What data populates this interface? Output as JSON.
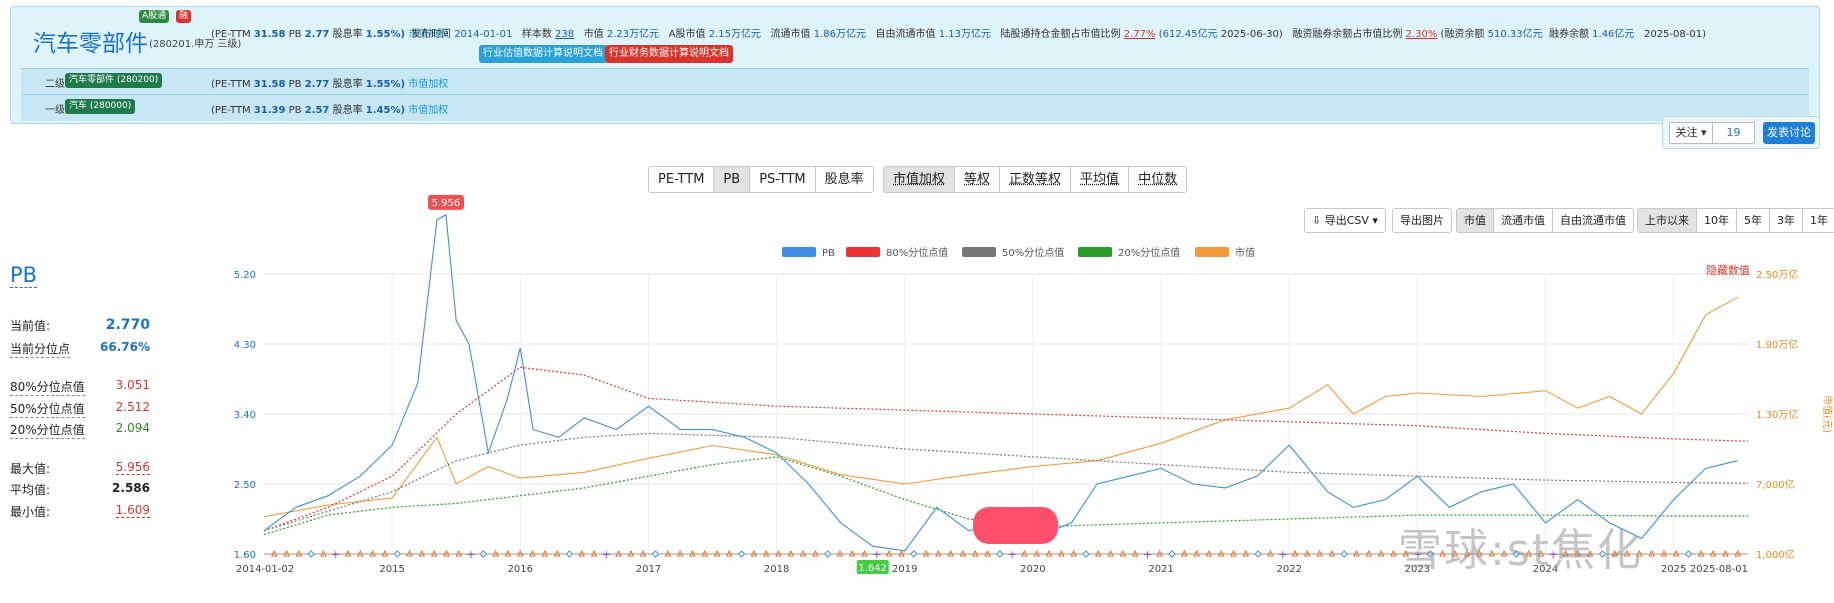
{
  "header": {
    "name": "汽车零部件",
    "code": "(280201.申万 三级)",
    "badges": {
      "ashare": "A股通",
      "margin": "融"
    },
    "valuation": {
      "pe_label": "(PE-TTM",
      "pe": "31.58",
      "pb_label": "PB",
      "pb": "2.77",
      "dy_label": "股息率",
      "dy": "1.55%)",
      "weight": "市值加权"
    },
    "info": {
      "pub_label": "发布时间",
      "pub_value": "2014-01-01",
      "samples_label": "样本数",
      "samples_value": "238",
      "mcap_label": "市值",
      "mcap_value": "2.23万亿元",
      "amcap_label": "A股市值",
      "amcap_value": "2.15万亿元",
      "float_label": "流通市值",
      "float_value": "1.86万亿元",
      "freefloat_label": "自由流通市值",
      "freefloat_value": "1.13万亿元",
      "hk_label": "陆股通持仓金额占市值比例",
      "hk_ratio": "2.77%",
      "hk_amount": "(612.45亿元",
      "hk_date": "2025-06-30)",
      "margin_label": "融资融券余额占市值比例",
      "margin_ratio": "2.30%",
      "margin_fin_label": "(融资余额",
      "margin_fin": "510.33亿元",
      "margin_sec_label": "融券余额",
      "margin_sec": "1.46亿元",
      "margin_date": "2025-08-01)"
    },
    "docs": {
      "val_doc": "行业估值数据计算说明文档",
      "fin_doc": "行业财务数据计算说明文档"
    }
  },
  "level2": {
    "label": "二级:",
    "tag": "汽车零部件 (280200)",
    "pe_label": "(PE-TTM",
    "pe": "31.58",
    "pb_label": "PB",
    "pb": "2.77",
    "dy_label": "股息率",
    "dy": "1.55%)",
    "weight": "市值加权"
  },
  "level1": {
    "label": "一级:",
    "tag": "汽车 (280000)",
    "pe_label": "(PE-TTM",
    "pe": "31.39",
    "pb_label": "PB",
    "pb": "2.57",
    "dy_label": "股息率",
    "dy": "1.45%)",
    "weight": "市值加权"
  },
  "actions": {
    "follow": "关注",
    "count": "19",
    "post": "发表讨论"
  },
  "metric_tabs": [
    "PE-TTM",
    "PB",
    "PS-TTM",
    "股息率"
  ],
  "metric_active": 1,
  "method_tabs": [
    "市值加权",
    "等权",
    "正数等权",
    "平均值",
    "中位数"
  ],
  "method_active": 0,
  "toolbar": {
    "export_csv": "导出CSV",
    "export_img": "导出图片"
  },
  "base_tabs": [
    "市值",
    "流通市值",
    "自由流通市值"
  ],
  "range_tabs": [
    "上市以来",
    "10年",
    "5年",
    "3年",
    "1年"
  ],
  "stats": {
    "title": "PB",
    "current_label": "当前值:",
    "current": "2.770",
    "pct_label": "当前分位点",
    "pct": "66.76%",
    "p80_label": "80%分位点值",
    "p80": "3.051",
    "p50_label": "50%分位点值",
    "p50": "2.512",
    "p20_label": "20%分位点值",
    "p20": "2.094",
    "max_label": "最大值:",
    "max": "5.956",
    "avg_label": "平均值:",
    "avg": "2.586",
    "min_label": "最小值:",
    "min": "1.609"
  },
  "watermark": "雪球:st焦化",
  "colors": {
    "pb": "#3c8ee6",
    "p80": "#ee3333",
    "p50": "#777777",
    "p20": "#2a9a2a",
    "mcap": "#f59a3c"
  },
  "chart_data": {
    "type": "line",
    "legend": [
      "PB",
      "80%分位点值",
      "50%分位点值",
      "20%分位点值",
      "市值"
    ],
    "hide_values": "隐藏数值",
    "x_ticks": [
      "2014-01-02",
      "2015",
      "2016",
      "2017",
      "2018",
      "2019",
      "2020",
      "2021",
      "2022",
      "2023",
      "2024",
      "2025",
      "2025-08-01"
    ],
    "y_left_ticks": [
      "1.60",
      "2.50",
      "3.40",
      "4.30",
      "5.20"
    ],
    "y_left_range": [
      1.6,
      5.2
    ],
    "y_right_ticks": [
      "1,000亿",
      "7,000亿",
      "1.30万亿",
      "1.90万亿",
      "2.50万亿"
    ],
    "y_right_range": [
      1000,
      25000
    ],
    "y_right_label": "市值(元)",
    "max_label": "5.956",
    "min_label": "1.642",
    "series": [
      {
        "name": "PB",
        "x": [
          2014.0,
          2014.25,
          2014.5,
          2014.75,
          2015.0,
          2015.2,
          2015.35,
          2015.42,
          2015.5,
          2015.6,
          2015.75,
          2015.9,
          2016.0,
          2016.1,
          2016.3,
          2016.5,
          2016.75,
          2017.0,
          2017.25,
          2017.5,
          2017.75,
          2018.0,
          2018.25,
          2018.5,
          2018.75,
          2019.0,
          2019.25,
          2019.5,
          2019.75,
          2020.0,
          2020.15,
          2020.3,
          2020.5,
          2020.75,
          2021.0,
          2021.25,
          2021.5,
          2021.75,
          2022.0,
          2022.3,
          2022.5,
          2022.75,
          2023.0,
          2023.25,
          2023.5,
          2023.75,
          2024.0,
          2024.25,
          2024.5,
          2024.75,
          2025.0,
          2025.25,
          2025.5
        ],
        "y": [
          1.9,
          2.2,
          2.35,
          2.6,
          3.0,
          3.8,
          5.9,
          5.96,
          4.6,
          4.3,
          2.9,
          3.6,
          4.25,
          3.2,
          3.1,
          3.35,
          3.2,
          3.5,
          3.2,
          3.2,
          3.1,
          2.9,
          2.5,
          2.0,
          1.7,
          1.64,
          2.2,
          1.9,
          2.0,
          2.1,
          1.9,
          2.0,
          2.5,
          2.6,
          2.7,
          2.5,
          2.45,
          2.6,
          3.0,
          2.4,
          2.2,
          2.3,
          2.6,
          2.2,
          2.4,
          2.5,
          2.0,
          2.3,
          2.0,
          1.8,
          2.3,
          2.7,
          2.8
        ]
      },
      {
        "name": "80%分位点值",
        "x": [
          2014.0,
          2014.5,
          2015.0,
          2015.5,
          2016.0,
          2016.5,
          2017.0,
          2018.0,
          2019.0,
          2020.0,
          2021.0,
          2022.0,
          2023.0,
          2024.0,
          2025.0,
          2025.58
        ],
        "y": [
          1.9,
          2.2,
          2.6,
          3.4,
          4.0,
          3.9,
          3.6,
          3.5,
          3.45,
          3.4,
          3.35,
          3.3,
          3.25,
          3.15,
          3.08,
          3.05
        ]
      },
      {
        "name": "50%分位点值",
        "x": [
          2014.0,
          2014.5,
          2015.0,
          2015.5,
          2016.0,
          2016.5,
          2017.0,
          2018.0,
          2019.0,
          2020.0,
          2021.0,
          2022.0,
          2023.0,
          2024.0,
          2025.0,
          2025.58
        ],
        "y": [
          1.9,
          2.15,
          2.4,
          2.8,
          3.0,
          3.1,
          3.15,
          3.1,
          2.95,
          2.85,
          2.75,
          2.65,
          2.6,
          2.55,
          2.52,
          2.51
        ]
      },
      {
        "name": "20%分位点值",
        "x": [
          2014.0,
          2014.5,
          2015.0,
          2015.5,
          2016.0,
          2016.5,
          2017.0,
          2017.5,
          2018.0,
          2018.5,
          2019.0,
          2019.5,
          2020.0,
          2021.0,
          2022.0,
          2023.0,
          2024.0,
          2025.0,
          2025.58
        ],
        "y": [
          1.85,
          2.1,
          2.2,
          2.25,
          2.35,
          2.45,
          2.6,
          2.75,
          2.85,
          2.6,
          2.3,
          2.05,
          1.95,
          2.0,
          2.05,
          2.1,
          2.1,
          2.09,
          2.09
        ]
      },
      {
        "name": "市值",
        "x": [
          2014.0,
          2014.5,
          2015.0,
          2015.35,
          2015.5,
          2015.75,
          2016.0,
          2016.5,
          2017.0,
          2017.5,
          2018.0,
          2018.5,
          2019.0,
          2019.5,
          2020.0,
          2020.5,
          2021.0,
          2021.5,
          2022.0,
          2022.3,
          2022.5,
          2022.75,
          2023.0,
          2023.5,
          2024.0,
          2024.25,
          2024.5,
          2024.75,
          2025.0,
          2025.25,
          2025.5
        ],
        "y": [
          4200,
          5200,
          5800,
          11000,
          7000,
          8500,
          7500,
          8000,
          9200,
          10300,
          9500,
          7800,
          7000,
          7800,
          8500,
          9000,
          10500,
          12500,
          13500,
          15500,
          13000,
          14500,
          14800,
          14500,
          15000,
          13500,
          14500,
          13000,
          16500,
          21500,
          23000
        ]
      }
    ]
  }
}
